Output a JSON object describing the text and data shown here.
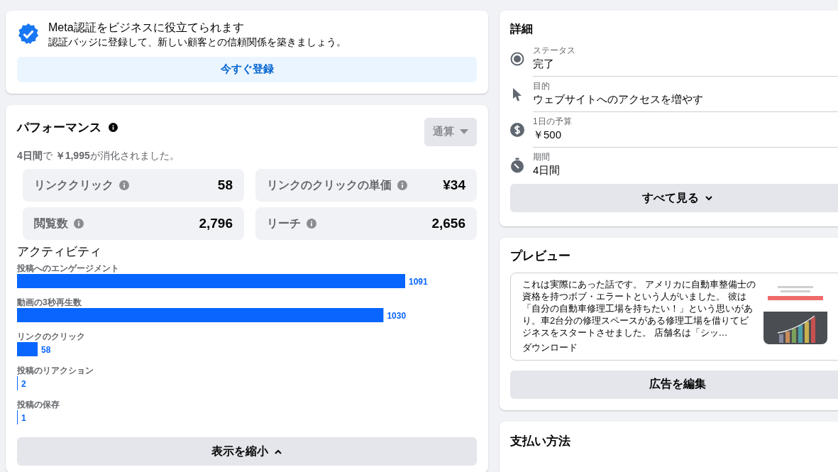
{
  "verification": {
    "title": "Meta認証をビジネスに役立てられます",
    "subtitle": "認証バッジに登録して、新しい顧客との信頼関係を築きましょう。",
    "button": "今すぐ登録"
  },
  "performance": {
    "title": "パフォーマンス",
    "range": {
      "label": "通算",
      "disabled": true
    },
    "summary": "**4日間**で **￥1,995**が消化されました。",
    "metrics": [
      {
        "label": "リンククリック",
        "value": "58"
      },
      {
        "label": "リンクのクリックの単価",
        "value": "¥34"
      },
      {
        "label": "閲覧数",
        "value": "2,796"
      },
      {
        "label": "リーチ",
        "value": "2,656"
      }
    ],
    "activity": {
      "title": "アクティビティ",
      "chart_data": {
        "type": "bar",
        "orientation": "horizontal",
        "categories": [
          "投稿へのエンゲージメント",
          "動画の3秒再生数",
          "リンクのクリック",
          "投稿のリアクション",
          "投稿の保存"
        ],
        "values": [
          1091,
          1030,
          58,
          2,
          1
        ],
        "data_labels": true
      }
    },
    "collapse_button": "表示を縮小"
  },
  "details": {
    "title": "詳細",
    "items": [
      {
        "kind": "status",
        "label": "ステータス",
        "value": "完了"
      },
      {
        "kind": "objective",
        "label": "目的",
        "value": "ウェブサイトへのアクセスを増やす"
      },
      {
        "kind": "budget",
        "label": "1日の予算",
        "value": "￥500"
      },
      {
        "kind": "duration",
        "label": "期間",
        "value": "4日間"
      }
    ],
    "button": "すべて見る"
  },
  "preview": {
    "title": "プレビュー",
    "ad_text": "これは実際にあった話です。 アメリカに自動車整備士の資格を持つボブ・エラートという人がいました。 彼は「自分の自動車修理工場を持ちたい！」という思いがあり。車2台分の修理スペースがある修理工場を借りてビジネスをスタートさせました。 店舗名は「シッ…",
    "cta": "ダウンロード",
    "button": "広告を編集"
  },
  "payment": {
    "title": "支払い方法"
  }
}
